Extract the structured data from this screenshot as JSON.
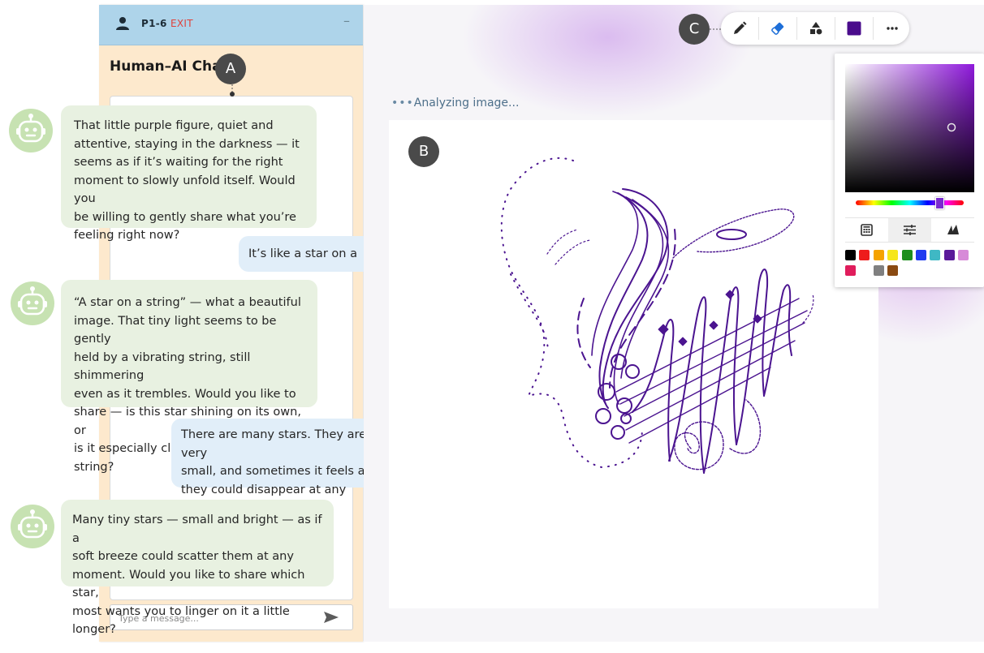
{
  "header": {
    "participant_id": "P1-6",
    "exit_label": "EXIT",
    "collapse_icon": "–"
  },
  "chat": {
    "title": "Human–AI Chat",
    "input_placeholder": "Type a message...",
    "messages": [
      {
        "role": "assistant",
        "lines": [
          "That little purple figure, quiet and",
          "attentive, staying in the darkness — it",
          "seems as if it’s waiting for the right",
          "moment to slowly unfold itself. Would you",
          "be willing to gently share what you’re",
          "feeling right now?"
        ]
      },
      {
        "role": "user",
        "lines": [
          "It’s like a star on a string."
        ]
      },
      {
        "role": "assistant",
        "lines": [
          "“A star on a string” — what a beautiful",
          "image. That tiny light seems to be gently",
          "held by a vibrating string, still shimmering",
          "even as it trembles. Would you like to",
          "share — is this star shining on its own, or",
          "is it especially close to a particular string?"
        ]
      },
      {
        "role": "user",
        "lines": [
          "There are many stars. They are very",
          "small, and sometimes it feels as if",
          "they could disappear at any moment."
        ]
      },
      {
        "role": "assistant",
        "lines": [
          "Many tiny stars — small and bright — as if a",
          "soft breeze could scatter them at any",
          "moment. Would you like to share which star,",
          "most wants you to linger on it a little longer?"
        ]
      }
    ]
  },
  "canvas": {
    "status_dots": "•••",
    "status_text": "Analyzing image..."
  },
  "markers": {
    "a": "A",
    "b": "B",
    "c": "C"
  },
  "toolbar": {
    "tools": [
      "pencil-icon",
      "eraser-icon",
      "shapes-icon",
      "color-icon",
      "more-icon"
    ],
    "current_color": "#4a0c8c"
  },
  "color_picker": {
    "base_hue_color": "#8f19dc",
    "tabs": [
      "palette-icon",
      "sliders-icon",
      "swatches-icon"
    ],
    "swatches_row1": [
      "#000000",
      "#ee1c1c",
      "#f5a300",
      "#f6e61c",
      "#1e8f1e",
      "#1f3cf0",
      "#3fb8c4",
      "#5a1a9a",
      "#d78ad8"
    ],
    "swatches_row2": [
      "#e01d5c",
      "#ffffff",
      "#808080",
      "#8a4a12"
    ]
  }
}
